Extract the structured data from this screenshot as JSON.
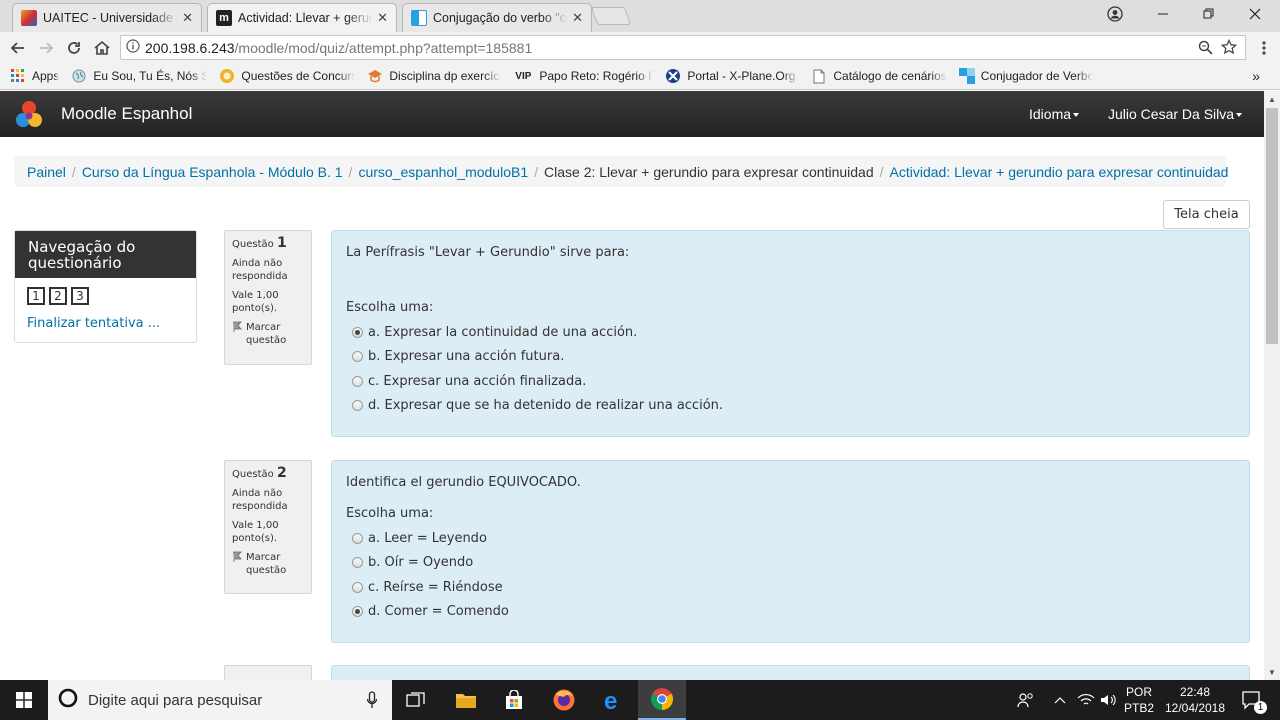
{
  "browser": {
    "tabs": [
      {
        "title": "UAITEC - Universidade A",
        "active": false
      },
      {
        "title": "Actividad: Llevar + gerun",
        "active": true
      },
      {
        "title": "Conjugação do verbo \"co",
        "active": false
      }
    ],
    "close_glyph": "✕",
    "url_host": "200.198.6.243",
    "url_path": "/moodle/mod/quiz/attempt.php?attempt=185881",
    "bookmarks": [
      {
        "label": "Apps",
        "icon": "apps-grid-icon"
      },
      {
        "label": "Eu Sou, Tu És, Nós Sc",
        "icon": "globe-icon"
      },
      {
        "label": "Questões de Concurs",
        "icon": "questoes-icon"
      },
      {
        "label": "Disciplina dp exercíci",
        "icon": "disciplina-icon"
      },
      {
        "label": "Papo Reto: Rogério Fe",
        "icon": "vip-icon"
      },
      {
        "label": "Portal - X-Plane.Org F",
        "icon": "xplane-icon"
      },
      {
        "label": "Catálogo de cenários",
        "icon": "page-icon"
      },
      {
        "label": "Conjugador de Verbo",
        "icon": "conjugador-icon"
      }
    ],
    "bookmarks_more": "»"
  },
  "site": {
    "brand": "Moodle Espanhol",
    "language_menu": "Idioma",
    "user_menu": "Julio Cesar Da Silva"
  },
  "breadcrumb": [
    {
      "label": "Painel",
      "link": true
    },
    {
      "label": "Curso da Língua Espanhola - Módulo B. 1",
      "link": true
    },
    {
      "label": "curso_espanhol_moduloB1",
      "link": true
    },
    {
      "label": "Clase 2: Llevar + gerundio para expresar continuidad",
      "link": false
    },
    {
      "label": "Actividad: Llevar + gerundio para expresar continuidad",
      "link": true
    }
  ],
  "fullscreen_label": "Tela cheia",
  "quiz_nav": {
    "title": "Navegação do questionário",
    "buttons": [
      "1",
      "2",
      "3"
    ],
    "finish_label": "Finalizar tentativa ..."
  },
  "questions": [
    {
      "label": "Questão",
      "number": "1",
      "state": "Ainda não respondida",
      "grade": "Vale 1,00 ponto(s).",
      "flag_label": "Marcar questão",
      "text": "La Perífrasis \"Levar + Gerundio\" sirve para:",
      "prompt": "Escolha uma:",
      "answers": [
        {
          "label": "a. Expresar la continuidad de una acción.",
          "checked": true
        },
        {
          "label": "b. Expresar una acción futura.",
          "checked": false
        },
        {
          "label": "c. Expresar una acción finalizada.",
          "checked": false
        },
        {
          "label": "d. Expresar que se ha detenido de realizar una acción.",
          "checked": false
        }
      ]
    },
    {
      "label": "Questão",
      "number": "2",
      "state": "Ainda não respondida",
      "grade": "Vale 1,00 ponto(s).",
      "flag_label": "Marcar questão",
      "text": "Identifica el gerundio EQUIVOCADO.",
      "prompt": "Escolha uma:",
      "answers": [
        {
          "label": "a. Leer = Leyendo",
          "checked": false
        },
        {
          "label": "b. Oír = Oyendo",
          "checked": false
        },
        {
          "label": "c. Reírse = Riéndose",
          "checked": false
        },
        {
          "label": "d. Comer = Comendo",
          "checked": true
        }
      ]
    }
  ],
  "taskbar": {
    "search_placeholder": "Digite aqui para pesquisar",
    "language_top": "POR",
    "language_bottom": "PTB2",
    "time": "22:48",
    "date": "12/04/2018",
    "notifications_count": "1"
  },
  "colors": {
    "link": "#0070a8",
    "question_bg": "#dcedf5",
    "navbar": "#2a2a2a",
    "taskbar": "#1c1c1c"
  }
}
